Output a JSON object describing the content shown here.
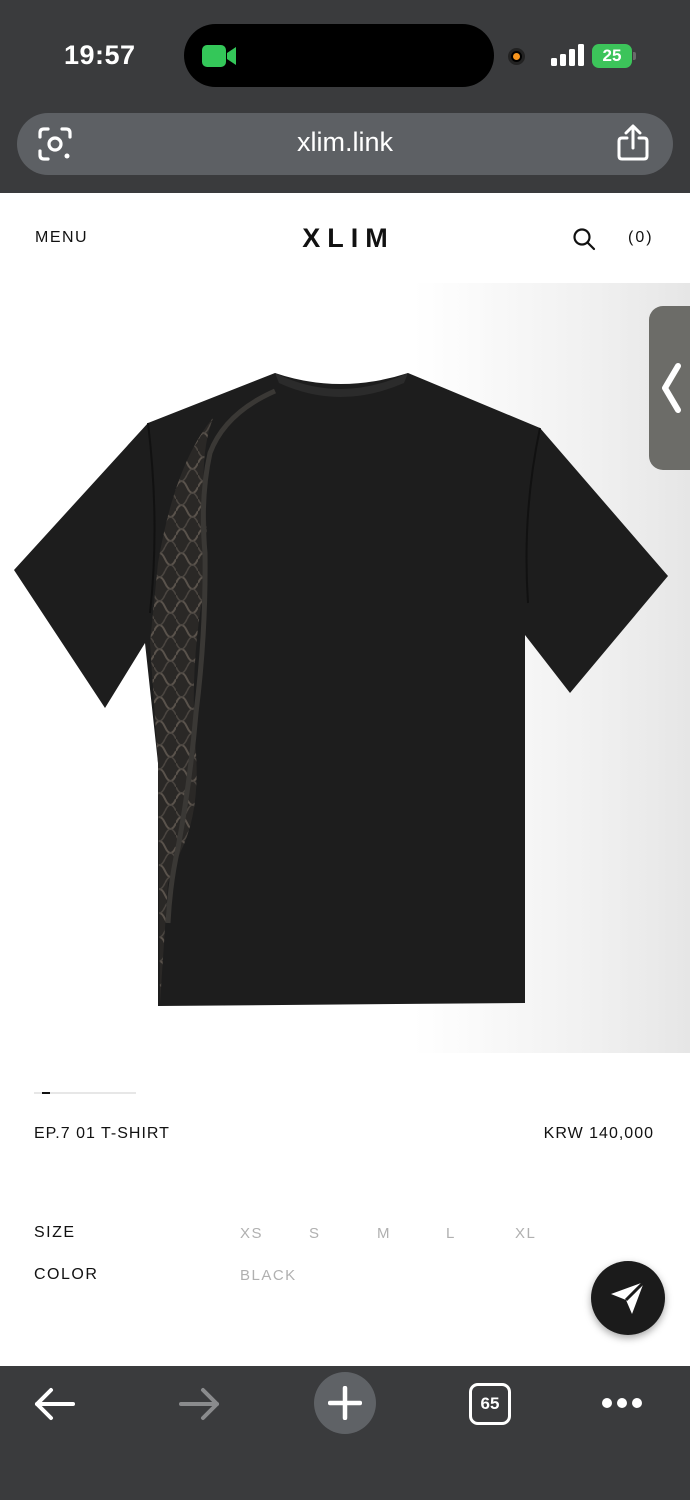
{
  "status_bar": {
    "time": "19:57",
    "battery": "25",
    "battery_color": "#3cc45a",
    "icons": [
      "facetime-camera-icon",
      "recording-dot-icon",
      "cellular-signal-icon",
      "battery-charging-icon"
    ]
  },
  "address_bar": {
    "url": "xlim.link",
    "left_icon": "visual-search-icon",
    "right_icon": "share-icon"
  },
  "site_header": {
    "menu_label": "MENU",
    "logo": "XLIM",
    "search_icon": "search-icon",
    "cart_label": "(0)"
  },
  "product": {
    "image_icon": "black-tshirt-image",
    "gallery_progress": 0.08,
    "name": "EP.7 01 T-SHIRT",
    "price": "KRW 140,000",
    "options": {
      "size_label": "SIZE",
      "sizes": [
        "XS",
        "S",
        "M",
        "L",
        "XL"
      ],
      "color_label": "COLOR",
      "colors": [
        "BLACK"
      ]
    }
  },
  "floating": {
    "side_tab_icon": "chevron-left-icon",
    "fab_icon": "send-icon"
  },
  "toolbar": {
    "back_icon": "arrow-left-icon",
    "forward_icon": "arrow-right-icon",
    "new_tab_icon": "plus-icon",
    "tab_count": "65",
    "more_icon": "more-dots-icon"
  }
}
